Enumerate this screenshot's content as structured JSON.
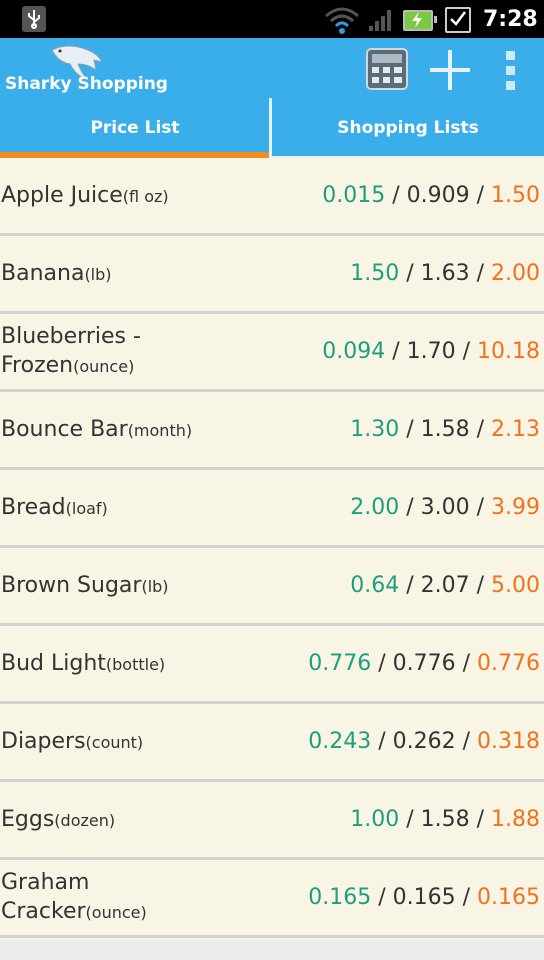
{
  "status_bar": {
    "time": "7:28"
  },
  "action_bar": {
    "title": "Sharky Shopping"
  },
  "tabs": [
    {
      "label": "Price List",
      "selected": true
    },
    {
      "label": "Shopping Lists",
      "selected": false
    }
  ],
  "colors": {
    "accent": "#3aaeeb",
    "indicator": "#f28c1f",
    "low": "#1f9e7e",
    "high": "#f2711c",
    "background": "#f8f5e4"
  },
  "items": [
    {
      "name": "Apple Juice",
      "unit": "(fl oz)",
      "low": "0.015",
      "avg": "0.909",
      "high": "1.50"
    },
    {
      "name": "Banana",
      "unit": "(lb)",
      "low": "1.50",
      "avg": "1.63",
      "high": "2.00"
    },
    {
      "name": "Blueberries - Frozen",
      "unit": "(ounce)",
      "low": "0.094",
      "avg": "1.70",
      "high": "10.18"
    },
    {
      "name": "Bounce Bar",
      "unit": "(month)",
      "low": "1.30",
      "avg": "1.58",
      "high": "2.13"
    },
    {
      "name": "Bread",
      "unit": "(loaf)",
      "low": "2.00",
      "avg": "3.00",
      "high": "3.99"
    },
    {
      "name": "Brown Sugar",
      "unit": "(lb)",
      "low": "0.64",
      "avg": "2.07",
      "high": "5.00"
    },
    {
      "name": "Bud Light",
      "unit": "(bottle)",
      "low": "0.776",
      "avg": "0.776",
      "high": "0.776"
    },
    {
      "name": "Diapers",
      "unit": "(count)",
      "low": "0.243",
      "avg": "0.262",
      "high": "0.318"
    },
    {
      "name": "Eggs",
      "unit": "(dozen)",
      "low": "1.00",
      "avg": "1.58",
      "high": "1.88"
    },
    {
      "name": "Graham Cracker",
      "unit": "(ounce)",
      "low": "0.165",
      "avg": "0.165",
      "high": "0.165"
    }
  ]
}
